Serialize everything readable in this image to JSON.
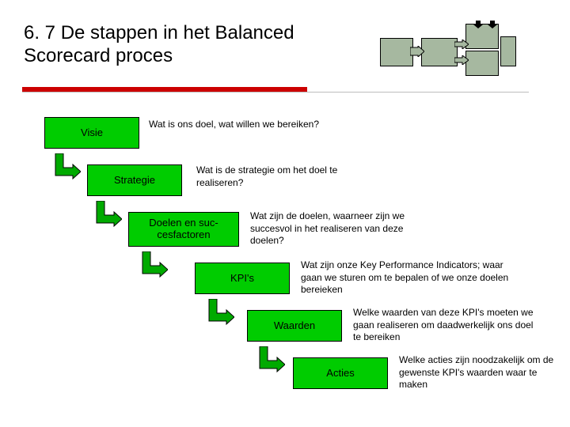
{
  "title": "6. 7 De stappen in het Balanced Scorecard proces",
  "steps": [
    {
      "label": "Visie",
      "desc": "Wat is ons doel, wat willen we bereiken?"
    },
    {
      "label": "Strategie",
      "desc": "Wat is de strategie om het doel te realiseren?"
    },
    {
      "label": "Doelen en suc-\ncesfactoren",
      "desc": "Wat zijn de doelen, waarneer zijn we succesvol in het realiseren van deze doelen?"
    },
    {
      "label": "KPI's",
      "desc": "Wat zijn onze Key Performance Indicators; waar gaan we sturen om te bepalen of we onze doelen bereieken"
    },
    {
      "label": "Waarden",
      "desc": "Welke waarden van deze KPI's moeten we gaan realiseren om daadwerkelijk ons doel te bereiken"
    },
    {
      "label": "Acties",
      "desc": "Welke acties zijn noodzakelijk om de gewenste KPI's waarden waar te maken"
    }
  ]
}
